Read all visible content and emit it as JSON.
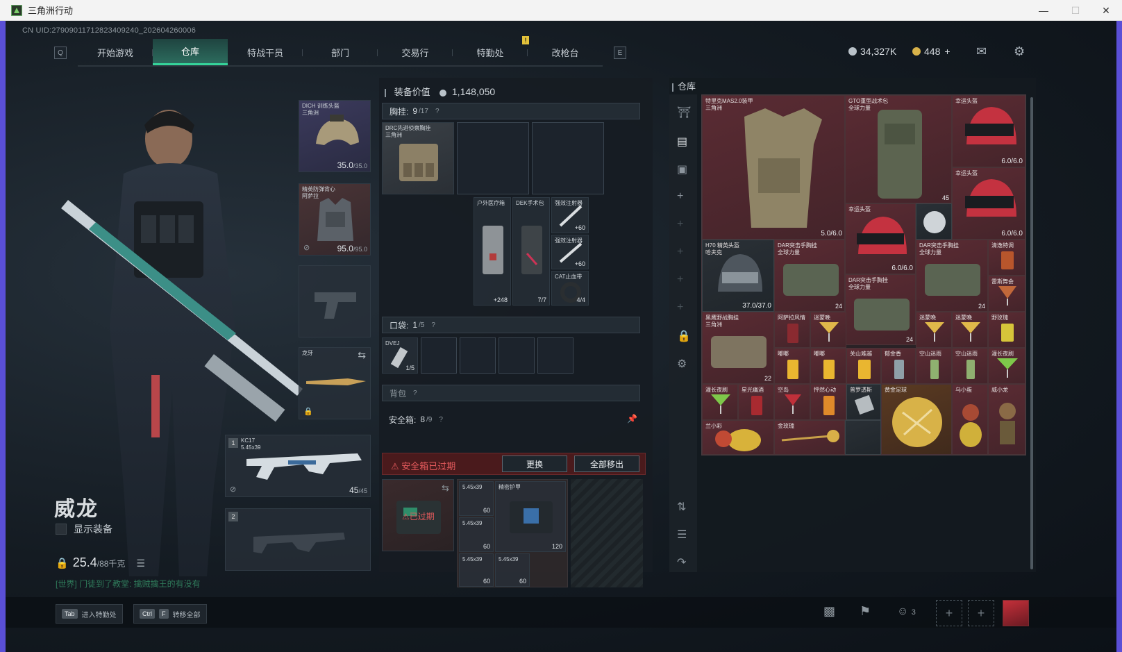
{
  "window": {
    "title": "三角洲行动"
  },
  "header": {
    "uid": "CN UID:2790901171282340924​0_202604260006",
    "nav_key_left": "Q",
    "nav_key_right": "E",
    "tabs": [
      "开始游戏",
      "仓库",
      "特战干员",
      "部门",
      "交易行",
      "特勤处",
      "改枪台"
    ],
    "active_tab": "仓库",
    "notification": "!",
    "currency_main": "34,327K",
    "currency_premium": "448",
    "premium_add": "+"
  },
  "character": {
    "name": "威龙",
    "show_equip_label": "显示装备",
    "weight_value": "25.4",
    "weight_capacity": "/88千克",
    "chat_line": "[世界] 门徒到了教堂: 擒贼擒王的有没有"
  },
  "gear_slots": {
    "helmet": {
      "label": "DICH 训练头盔",
      "sub": "三角洲",
      "durability": "35.0",
      "max": "/35.0"
    },
    "armor": {
      "label": "精英防弹背心",
      "sub": "阿萨拉",
      "durability": "95.0",
      "max": "/95.0"
    },
    "melee": {
      "label": "龙牙"
    },
    "primary": {
      "index": "1",
      "label": "KC17",
      "ammo_type": "5.45x39",
      "ammo": "45",
      "ammo_max": "/45"
    },
    "secondary": {
      "index": "2"
    }
  },
  "equipment": {
    "value_label": "装备价值",
    "value": "1,148,050",
    "chest_rig": {
      "label": "胸挂:",
      "used": "9",
      "cap": "/17",
      "q": "?"
    },
    "chest_item": {
      "label": "DRC先进侦察胸挂",
      "sub": "三角洲"
    },
    "rig_items": [
      {
        "label": "户外医疗箱",
        "count": "+248"
      },
      {
        "label": "DEK手术包",
        "count": "7/7"
      },
      {
        "label": "强效注射器",
        "count": "+60"
      },
      {
        "label": "强效注射器",
        "count": "+60"
      },
      {
        "label": "CAT止血带",
        "count": "4/4"
      }
    ],
    "pocket": {
      "label": "口袋:",
      "used": "1",
      "cap": "/5",
      "q": "?"
    },
    "pocket_item": {
      "label": "DVEJ",
      "count": "1/5"
    },
    "backpack": {
      "label": "背包",
      "q": "?"
    },
    "safe_box": {
      "label": "安全箱:",
      "used": "8",
      "cap": "/9",
      "q": "?"
    },
    "safe_warning": "安全箱已过期",
    "replace_label": "更换",
    "remove_all_label": "全部移出",
    "expired_label": "已过期",
    "safe_items": [
      {
        "label": "5.45x39",
        "count": "60"
      },
      {
        "label": "5.45x39",
        "count": "60"
      },
      {
        "label": "5.45x39",
        "count": "60"
      },
      {
        "label": "5.45x39",
        "count": "60"
      },
      {
        "label": "精密护甲",
        "count": "120"
      }
    ]
  },
  "warehouse": {
    "title": "仓库",
    "items": [
      {
        "label": "特里克MAS2.0装甲",
        "sub": "三角洲",
        "value": "5.0/6.0"
      },
      {
        "label": "GTO重型战术包",
        "sub": "全球力量",
        "value": "45"
      },
      {
        "label": "幸运头盔",
        "value": "6.0/6.0"
      },
      {
        "label": "幸运头盔",
        "value": "6.0/6.0"
      },
      {
        "label": "幸运头盔",
        "value": "6.0/6.0"
      },
      {
        "label": "H70 精英头盔",
        "sub": "哈夫克",
        "value": "37.0/37.0"
      },
      {
        "label": "DAR突击手胸挂",
        "sub": "全球力量",
        "value": "24"
      },
      {
        "label": "DAR突击手胸挂",
        "sub": "全球力量",
        "value": "24"
      },
      {
        "label": "DAR突击手胸挂",
        "sub": "全球力量",
        "value": "24"
      },
      {
        "label": "清逸特调",
        "value": ""
      },
      {
        "label": "雷斯舞会",
        "value": ""
      },
      {
        "label": "黑鹰野战胸挂",
        "sub": "三角洲",
        "value": "22"
      },
      {
        "label": "阿萨拉风情",
        "value": ""
      },
      {
        "label": "迷蒙晚",
        "value": ""
      },
      {
        "label": "迷蒙晚",
        "value": ""
      },
      {
        "label": "迷蒙晚",
        "value": ""
      },
      {
        "label": "野玫瑰",
        "value": ""
      },
      {
        "label": "嘟嘟",
        "value": ""
      },
      {
        "label": "嘟嘟",
        "value": ""
      },
      {
        "label": "关山难越",
        "value": ""
      },
      {
        "label": "郁金香",
        "value": ""
      },
      {
        "label": "空山迷雨",
        "value": ""
      },
      {
        "label": "空山迷雨",
        "value": ""
      },
      {
        "label": "灌长夜刷",
        "value": ""
      },
      {
        "label": "灌长夜刷",
        "value": ""
      },
      {
        "label": "星光痛酒",
        "value": ""
      },
      {
        "label": "空岛",
        "value": ""
      },
      {
        "label": "怦然心动",
        "value": ""
      },
      {
        "label": "普罗透斯",
        "value": ""
      },
      {
        "label": "黄金足球",
        "value": ""
      },
      {
        "label": "乌小蛋",
        "value": ""
      },
      {
        "label": "威小龙",
        "value": ""
      },
      {
        "label": "兰小彩",
        "value": ""
      },
      {
        "label": "金玫瑰",
        "value": ""
      }
    ]
  },
  "bottom": {
    "hotkey1_key": "Tab",
    "hotkey1_label": "进入特勤处",
    "hotkey2_key1": "Ctrl",
    "hotkey2_key2": "F",
    "hotkey2_label": "转移全部",
    "friends_count": "3"
  },
  "colors": {
    "accent": "#35d49a",
    "warning": "#e2595b",
    "rarity_red": "#5a2b33"
  }
}
